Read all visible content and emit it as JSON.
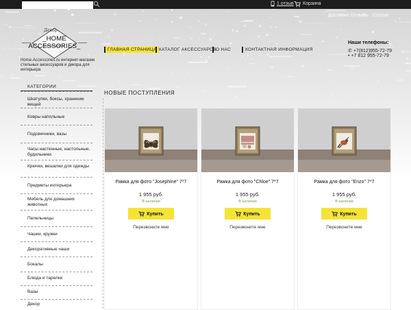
{
  "topbar": {
    "reviews": "1 отзыв",
    "cart": "Корзина"
  },
  "topnav": [
    "Доставка",
    "Отзывы",
    "Статьи"
  ],
  "logo": {
    "top": "Декор",
    "main": "_HOME ACCESSORIES_",
    "bottom": "Аксессуары"
  },
  "tagline": "Home-Accessories.ru интернет-магазин стильных аксессуаров и декора для интерьера",
  "mainnav": [
    "ГЛАВНАЯ СТРАНИЦА",
    "КАТАЛОГ АКСЕССУАРОВ",
    "О НАС",
    "КОНТАКТНАЯ ИНФОРМАЦИЯ"
  ],
  "phones": {
    "title": "Наши телефоны:",
    "list": [
      "+7(812)955-72-79",
      "+7 812 955-72-79"
    ]
  },
  "sidebar": {
    "title": "КАТЕГОРИИ",
    "items": [
      "Шкатулки, боксы, хранение вещей",
      "Ковры напольные",
      "Подсвечники, вазы",
      "Часы настенные, настольные, будильники.",
      "Крючки, вешалки для одежды",
      "Предметы интерьера",
      "Мебель для домашних животных",
      "Пепельницы",
      "Чашки, кружки",
      "Декоративные чаши",
      "Бокалы",
      "Блюда и тарелки",
      "Вазы",
      "Декор"
    ]
  },
  "main": {
    "section_title": "НОВЫЕ ПОСТУПЛЕНИЯ",
    "products": [
      {
        "name": "Рамка для фото \"Josephine\" 7*7",
        "price": "1 955 руб.",
        "stock": "В наличии",
        "buy": "Купить",
        "callback": "Перезвоните мне",
        "picture": "butterfly"
      },
      {
        "name": "Рамка для фото \"Chloe\" 7*7",
        "price": "1 955 руб.",
        "stock": "В наличии",
        "buy": "Купить",
        "callback": "Перезвоните мне",
        "picture": "flowers"
      },
      {
        "name": "Рамка для фото \"Enzo\" 7*7",
        "price": "1 955 руб.",
        "stock": "В наличии",
        "buy": "Купить",
        "callback": "Перезвоните мне",
        "picture": "bird"
      }
    ]
  },
  "colors": {
    "accent": "#f5e336",
    "topbar": "#1d1d1d",
    "stock": "#7a9f3a"
  }
}
